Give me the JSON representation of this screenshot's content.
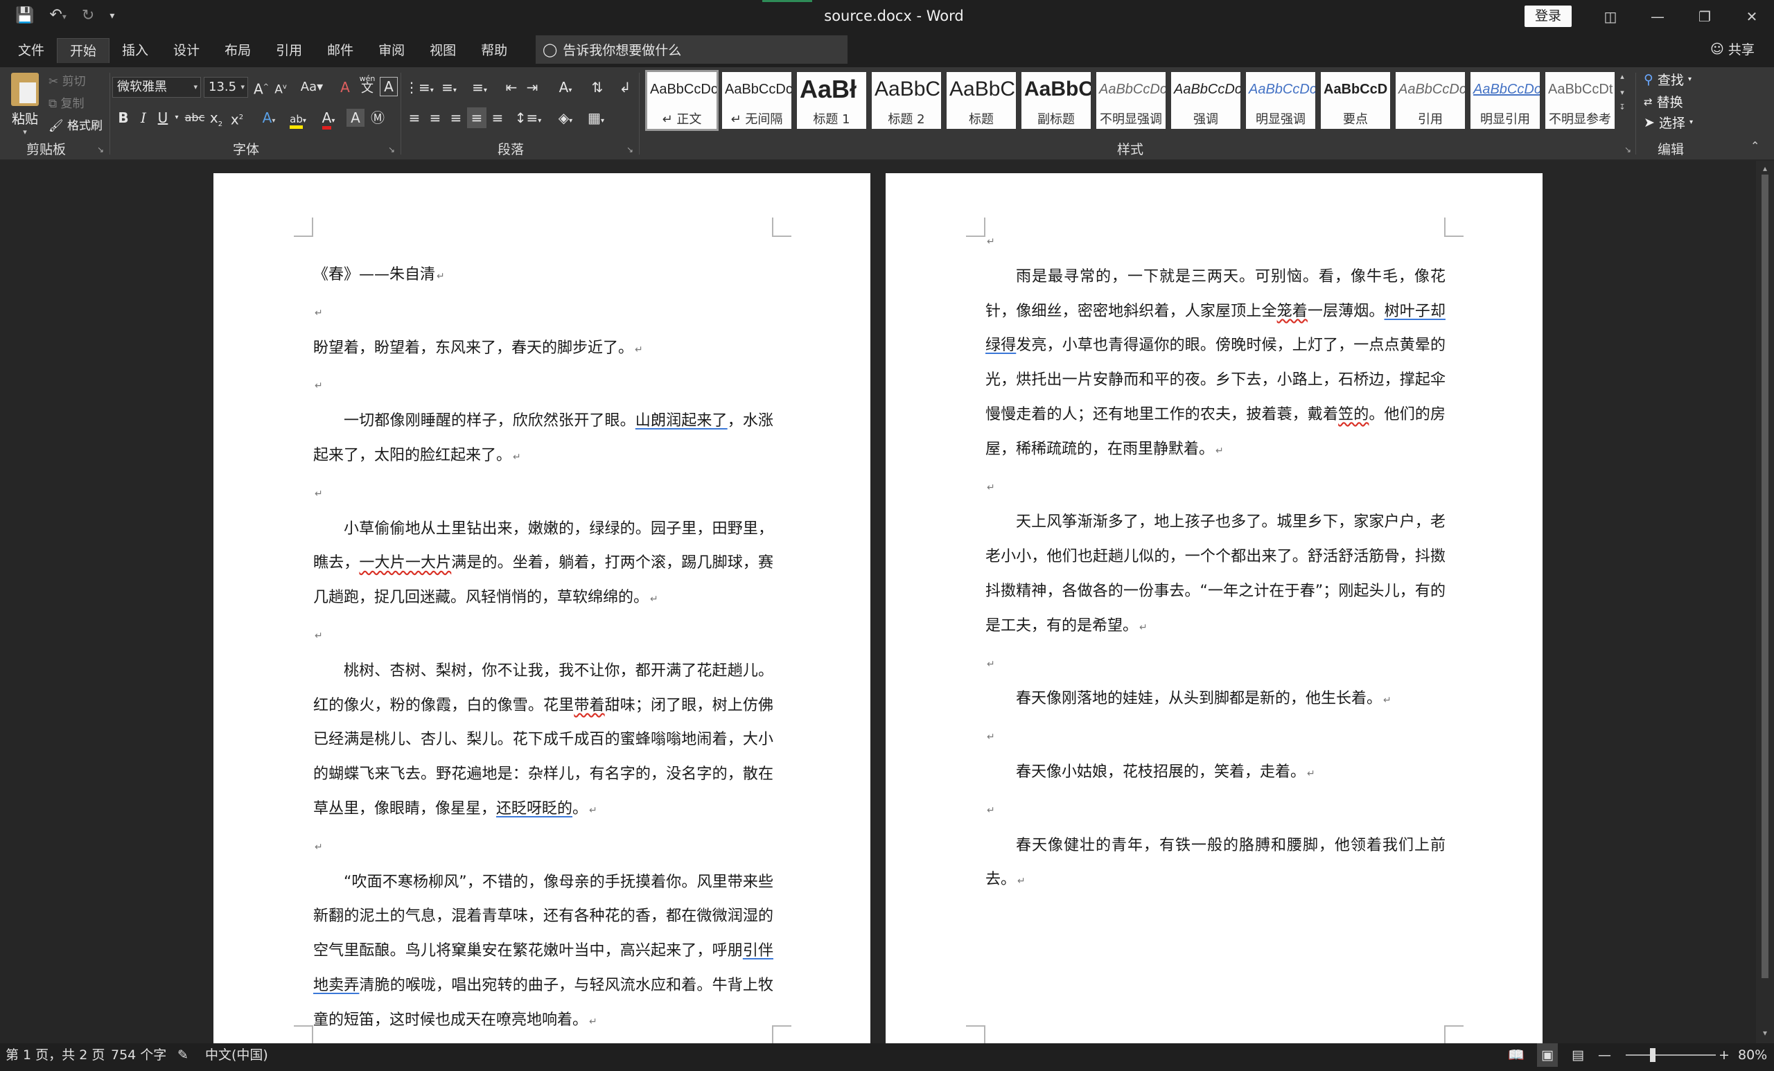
{
  "titlebar": {
    "title": "source.docx  -  Word",
    "login": "登录",
    "qat_icons": [
      "save-icon",
      "undo-icon",
      "redo-icon",
      "customize-icon"
    ]
  },
  "tabs": [
    "文件",
    "开始",
    "插入",
    "设计",
    "布局",
    "引用",
    "邮件",
    "审阅",
    "视图",
    "帮助"
  ],
  "active_tab": "开始",
  "tellme": "告诉我你想要做什么",
  "share": "共享",
  "clipboard": {
    "paste": "粘贴",
    "cut": "剪切",
    "copy": "复制",
    "format_painter": "格式刷",
    "label": "剪贴板"
  },
  "font": {
    "name": "微软雅黑",
    "size": "13.5",
    "label": "字体",
    "wen": "wén"
  },
  "paragraph": {
    "label": "段落"
  },
  "styles": {
    "label": "样式",
    "items": [
      {
        "sample": "AaBbCcDc",
        "name": "↵ 正文"
      },
      {
        "sample": "AaBbCcDc",
        "name": "↵ 无间隔"
      },
      {
        "sample": "AaBł",
        "name": "标题 1"
      },
      {
        "sample": "AaBbC",
        "name": "标题 2"
      },
      {
        "sample": "AaBbC",
        "name": "标题"
      },
      {
        "sample": "AaBbC",
        "name": "副标题"
      },
      {
        "sample": "AaBbCcDc",
        "name": "不明显强调"
      },
      {
        "sample": "AaBbCcDc",
        "name": "强调"
      },
      {
        "sample": "AaBbCcDc",
        "name": "明显强调"
      },
      {
        "sample": "AaBbCcD",
        "name": "要点"
      },
      {
        "sample": "AaBbCcDc",
        "name": "引用"
      },
      {
        "sample": "AaBbCcDc",
        "name": "明显引用"
      },
      {
        "sample": "AaBbCcDt",
        "name": "不明显参考"
      }
    ]
  },
  "editing": {
    "find": "查找",
    "replace": "替换",
    "select": "选择",
    "label": "编辑"
  },
  "document": {
    "page1": {
      "title": "《春》——朱自清",
      "p1": "盼望着，盼望着，东风来了，春天的脚步近了。",
      "p2a": "一切都像刚睡醒的样子，欣欣然张开了眼。",
      "p2b": "山朗润起来了",
      "p2c": "，水涨起来了，太阳的脸红起来了。",
      "p3a": "小草偷偷地从土里钻出来，嫩嫩的，绿绿的。园子里，田野里，瞧去，",
      "p3b": "一大片一大片",
      "p3c": "满是的。坐着，躺着，打两个滚，踢几脚球，赛几趟跑，捉几回迷藏。风轻悄悄的，草软绵绵的。",
      "p4a": "桃树、杏树、梨树，你不让我，我不让你，都开满了花赶趟儿。红的像火，粉的像霞，白的像雪。花里",
      "p4b": "带着",
      "p4c": "甜味；闭了眼，树上仿佛已经满是桃儿、杏儿、梨儿。花下成千成百的蜜蜂嗡嗡地闹着，大小的蝴蝶飞来飞去。野花遍地是：杂样儿，有名字的，没名字的，散在草丛里，像眼睛，像星星，",
      "p4d": "还眨呀眨的",
      "p4e": "。",
      "p5a": "“吹面不寒杨柳风”，不错的，像母亲的手抚摸着你。风里带来些新翻的泥土的气息，混着青草味，还有各种花的香，都在微微润湿的空气里酝酿。鸟儿将窠巢安在繁花嫩叶当中，高兴起来了，呼朋",
      "p5b": "引伴地卖弄",
      "p5c": "清脆的喉咙，唱出宛转的曲子，与轻风流水应和着。牛背上牧童的短笛，这时候也成天在嘹亮地响着。"
    },
    "page2": {
      "p1a": "雨是最寻常的，一下就是三两天。可别恼。看，像牛毛，像花针，像细丝，密密地斜织着，人家屋顶上全",
      "p1b": "笼着",
      "p1c": "一层薄烟。",
      "p1d": "树叶子却绿得",
      "p1e": "发亮，小草也青得逼你的眼。傍晚时候，上灯了，一点点黄晕的光，烘托出一片安静而和平的夜。乡下去，小路上，石桥边，撑起伞慢慢走着的人；还有地里工作的农夫，披着蓑，戴着",
      "p1f": "笠的",
      "p1g": "。他们的房屋，稀稀疏疏的，在雨里静默着。",
      "p2": "天上风筝渐渐多了，地上孩子也多了。城里乡下，家家户户，老老小小，他们也赶趟儿似的，一个个都出来了。舒活舒活筋骨，抖擞抖擞精神，各做各的一份事去。“一年之计在于春”；刚起头儿，有的是工夫，有的是希望。",
      "p3": "春天像刚落地的娃娃，从头到脚都是新的，他生长着。",
      "p4": "春天像小姑娘，花枝招展的，笑着，走着。",
      "p5": "春天像健壮的青年，有铁一般的胳膊和腰脚，他领着我们上前去。"
    }
  },
  "statusbar": {
    "page": "第 1 页，共 2 页",
    "words": "754 个字",
    "lang": "中文(中国)",
    "zoom": "80%"
  }
}
